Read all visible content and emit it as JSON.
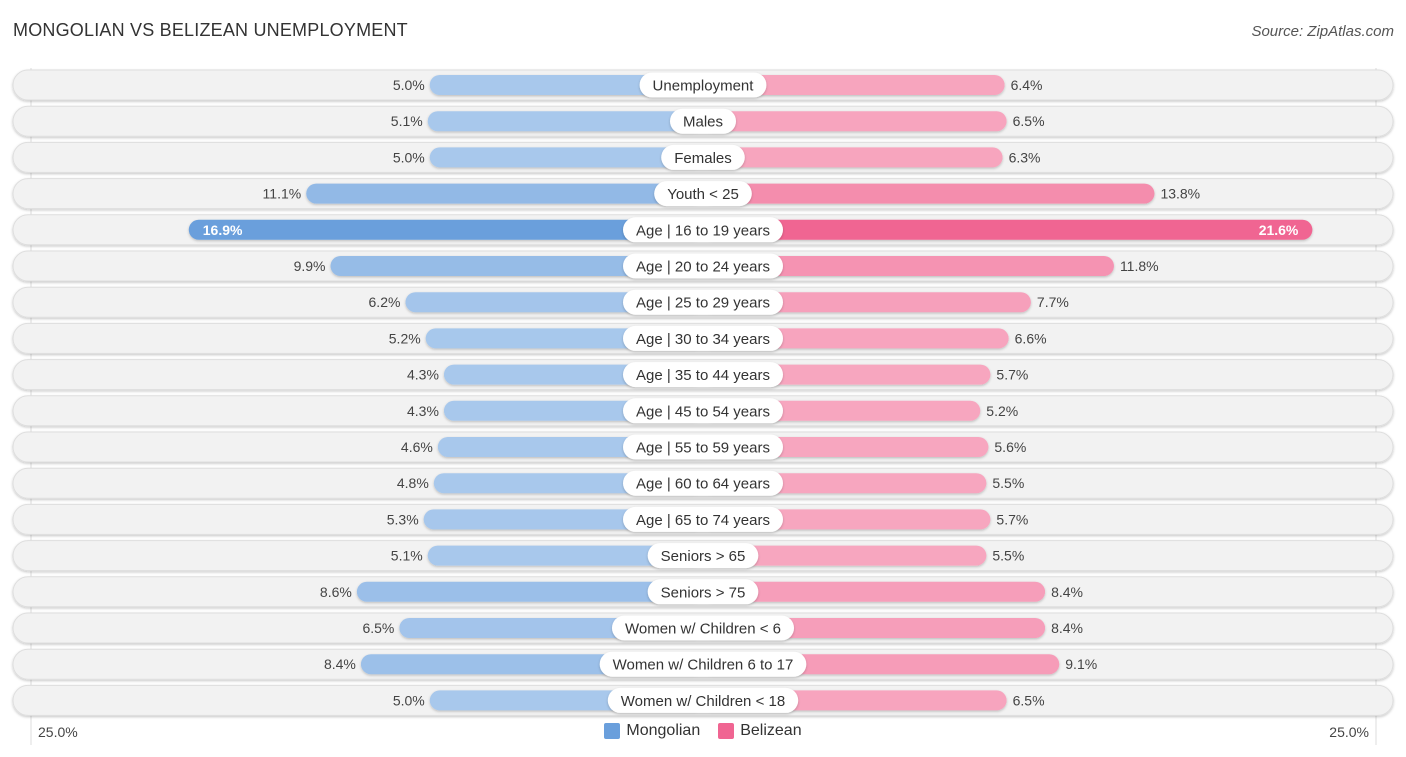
{
  "header": {
    "title": "MONGOLIAN VS BELIZEAN UNEMPLOYMENT",
    "source": "Source: ZipAtlas.com"
  },
  "axis": {
    "left_label": "25.0%",
    "right_label": "25.0%"
  },
  "legend": [
    {
      "name": "Mongolian",
      "color": "#6a9fdc"
    },
    {
      "name": "Belizean",
      "color": "#f06592"
    }
  ],
  "colors": {
    "mongolian_light": "#a8c8ec",
    "mongolian_strong": "#6a9fdc",
    "belizean_light": "#f7a6bf",
    "belizean_strong": "#f06592",
    "track": "#f2f2f2"
  },
  "chart_data": {
    "type": "bar",
    "orientation": "horizontal-diverging",
    "title": "MONGOLIAN VS BELIZEAN UNEMPLOYMENT",
    "xlim": [
      -25,
      25
    ],
    "xlabel": "",
    "ylabel": "",
    "tick_labels": [
      "25.0%",
      "25.0%"
    ],
    "legend_position": "bottom-center",
    "categories": [
      "Unemployment",
      "Males",
      "Females",
      "Youth < 25",
      "Age | 16 to 19 years",
      "Age | 20 to 24 years",
      "Age | 25 to 29 years",
      "Age | 30 to 34 years",
      "Age | 35 to 44 years",
      "Age | 45 to 54 years",
      "Age | 55 to 59 years",
      "Age | 60 to 64 years",
      "Age | 65 to 74 years",
      "Seniors > 65",
      "Seniors > 75",
      "Women w/ Children < 6",
      "Women w/ Children 6 to 17",
      "Women w/ Children < 18"
    ],
    "series": [
      {
        "name": "Mongolian",
        "side": "left",
        "values": [
          5.0,
          5.1,
          5.0,
          11.1,
          16.9,
          9.9,
          6.2,
          5.2,
          4.3,
          4.3,
          4.6,
          4.8,
          5.3,
          5.1,
          8.6,
          6.5,
          8.4,
          5.0
        ]
      },
      {
        "name": "Belizean",
        "side": "right",
        "values": [
          6.4,
          6.5,
          6.3,
          13.8,
          21.6,
          11.8,
          7.7,
          6.6,
          5.7,
          5.2,
          5.6,
          5.5,
          5.7,
          5.5,
          8.4,
          8.4,
          9.1,
          6.5
        ]
      }
    ],
    "highlighted_row": "Age | 16 to 19 years"
  }
}
